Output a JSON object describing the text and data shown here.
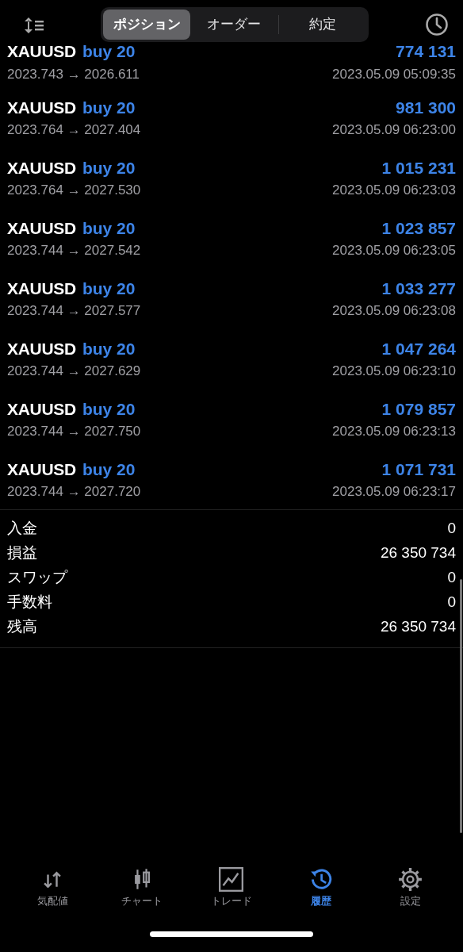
{
  "segments": [
    {
      "label": "ポジション",
      "selected": true
    },
    {
      "label": "オーダー",
      "selected": false
    },
    {
      "label": "約定",
      "selected": false
    }
  ],
  "deals": [
    {
      "symbol": "XAUUSD",
      "side": "buy 20",
      "profit": "774 131",
      "prices": "2023.743 → 2026.611",
      "time": "2023.05.09 05:09:35"
    },
    {
      "symbol": "XAUUSD",
      "side": "buy 20",
      "profit": "981 300",
      "prices": "2023.764 → 2027.404",
      "time": "2023.05.09 06:23:00"
    },
    {
      "symbol": "XAUUSD",
      "side": "buy 20",
      "profit": "1 015 231",
      "prices": "2023.764 → 2027.530",
      "time": "2023.05.09 06:23:03"
    },
    {
      "symbol": "XAUUSD",
      "side": "buy 20",
      "profit": "1 023 857",
      "prices": "2023.744 → 2027.542",
      "time": "2023.05.09 06:23:05"
    },
    {
      "symbol": "XAUUSD",
      "side": "buy 20",
      "profit": "1 033 277",
      "prices": "2023.744 → 2027.577",
      "time": "2023.05.09 06:23:08"
    },
    {
      "symbol": "XAUUSD",
      "side": "buy 20",
      "profit": "1 047 264",
      "prices": "2023.744 → 2027.629",
      "time": "2023.05.09 06:23:10"
    },
    {
      "symbol": "XAUUSD",
      "side": "buy 20",
      "profit": "1 079 857",
      "prices": "2023.744 → 2027.750",
      "time": "2023.05.09 06:23:13"
    },
    {
      "symbol": "XAUUSD",
      "side": "buy 20",
      "profit": "1 071 731",
      "prices": "2023.744 → 2027.720",
      "time": "2023.05.09 06:23:17"
    }
  ],
  "summary": [
    {
      "label": "入金",
      "value": "0"
    },
    {
      "label": "損益",
      "value": "26 350 734"
    },
    {
      "label": "スワップ",
      "value": "0"
    },
    {
      "label": "手数料",
      "value": "0"
    },
    {
      "label": "残高",
      "value": "26 350 734"
    }
  ],
  "tab_bar": [
    {
      "kind": "quotes",
      "label": "気配値",
      "selected": false
    },
    {
      "kind": "chart",
      "label": "チャート",
      "selected": false
    },
    {
      "kind": "trade",
      "label": "トレード",
      "selected": false
    },
    {
      "kind": "history",
      "label": "履歴",
      "selected": true
    },
    {
      "kind": "settings",
      "label": "設定",
      "selected": false
    }
  ]
}
